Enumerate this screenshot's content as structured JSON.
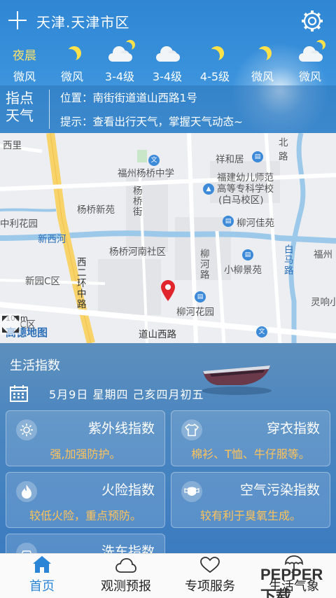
{
  "header": {
    "location_title": "天津.天津市区"
  },
  "forecast": [
    {
      "label": "夜晨",
      "icon": "none",
      "wind": "微风"
    },
    {
      "label": "",
      "icon": "moon-icon",
      "wind": "微风"
    },
    {
      "label": "",
      "icon": "cloud-moon-icon",
      "wind": "3-4级"
    },
    {
      "label": "",
      "icon": "cloud-icon",
      "wind": "3-4级"
    },
    {
      "label": "",
      "icon": "moon-icon",
      "wind": "4-5级"
    },
    {
      "label": "",
      "icon": "moon-icon",
      "wind": "微风"
    },
    {
      "label": "",
      "icon": "cloud-moon-icon",
      "wind": "微风"
    }
  ],
  "info": {
    "brand_line1": "指点",
    "brand_line2": "天气",
    "position": "位置：南街街道道山西路1号",
    "tip": "提示：查看出行天气，掌握天气动态~"
  },
  "map": {
    "labels": {
      "school": "福州杨桥中学",
      "xiangheju": "祥和居",
      "normal_college_1": "福建幼儿师范",
      "normal_college_2": "高等专科学校",
      "normal_college_3": "(白马校区)",
      "yangqiao_xinyuan": "杨桥新苑",
      "yangqiao_jie_1": "杨",
      "yangqiao_jie_2": "桥",
      "yangqiao_jie_3": "街",
      "liuhe_jiayuan": "柳河佳苑",
      "lihuayuan": "中利花园",
      "xinxihe": "新西河",
      "yangqiao_south": "杨桥河南社区",
      "liuhe_road_1": "柳",
      "liuhe_road_2": "河",
      "liuhe_road_3": "路",
      "xiaoliu": "小柳景苑",
      "xinyuan_c": "新园C区",
      "xierhuan_1": "西",
      "xierhuan_2": "二",
      "xierhuan_3": "环",
      "xierhuan_4": "中",
      "xierhuan_5": "路",
      "liuhe_garden": "柳河花园",
      "baima_1": "白",
      "baima_2": "马",
      "baima_3": "路",
      "fuzhou_edge": "福州",
      "lingying": "灵响小",
      "beilu_1": "北",
      "beilu_2": "路",
      "xili": "西里",
      "daoshan_road": "道山西路",
      "district_c": "C区",
      "scale": "100m",
      "amap": "高德地图"
    }
  },
  "life": {
    "title": "生活指数",
    "date": "5月9日   星期四   己亥四月初五",
    "cards": [
      {
        "title": "紫外线指数",
        "desc": "强,加强防护。",
        "icon": "sun-icon"
      },
      {
        "title": "穿衣指数",
        "desc": "棉衫、T恤、牛仔服等。",
        "icon": "shirt-icon"
      },
      {
        "title": "火险指数",
        "desc": "较低火险，重点预防。",
        "icon": "fire-icon"
      },
      {
        "title": "空气污染指数",
        "desc": "较有利于臭氧生成。",
        "icon": "mask-icon"
      },
      {
        "title": "洗车指数",
        "desc": "",
        "icon": "car-wash-icon"
      }
    ]
  },
  "nav": {
    "items": [
      {
        "label": "首页",
        "icon": "home-icon"
      },
      {
        "label": "观测预报",
        "icon": "cloud-icon"
      },
      {
        "label": "专项服务",
        "icon": "heart-icon"
      },
      {
        "label": "生活气象",
        "icon": "umbrella-icon"
      }
    ],
    "watermark": "PEPPER下载"
  },
  "colors": {
    "accent": "#2a85d6",
    "highlight": "#ffc35a",
    "yellow": "#ffe36a"
  }
}
